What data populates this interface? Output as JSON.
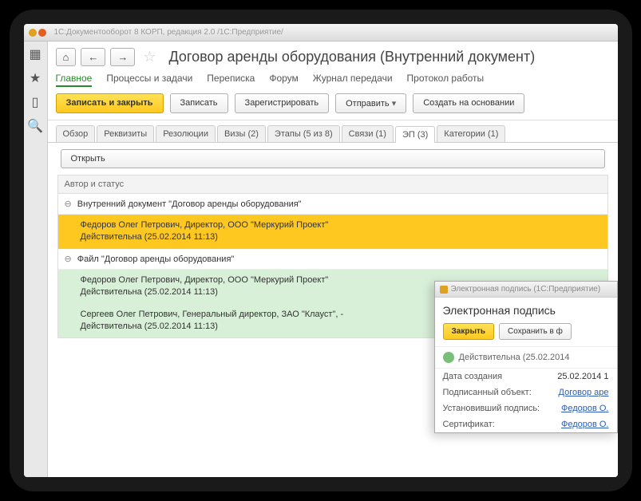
{
  "window": {
    "title": "1С:Документооборот 8 КОРП, редакция 2.0 /1С:Предприятие/"
  },
  "page": {
    "title": "Договор аренды оборудования (Внутренний документ)"
  },
  "nav": {
    "tabs": [
      {
        "label": "Главное"
      },
      {
        "label": "Процессы и задачи"
      },
      {
        "label": "Переписка"
      },
      {
        "label": "Форум"
      },
      {
        "label": "Журнал передачи"
      },
      {
        "label": "Протокол работы"
      }
    ]
  },
  "actions": {
    "save_close": "Записать и закрыть",
    "save": "Записать",
    "register": "Зарегистрировать",
    "send": "Отправить",
    "create_based": "Создать на основании"
  },
  "sub_tabs": [
    {
      "label": "Обзор"
    },
    {
      "label": "Реквизиты"
    },
    {
      "label": "Резолюции"
    },
    {
      "label": "Визы (2)"
    },
    {
      "label": "Этапы (5 из 8)"
    },
    {
      "label": "Связи (1)"
    },
    {
      "label": "ЭП (3)"
    },
    {
      "label": "Категории (1)"
    }
  ],
  "open_label": "Открыть",
  "list": {
    "header": "Автор и статус",
    "rows": [
      {
        "type": "group",
        "label": "Внутренний документ \"Договор аренды оборудования\""
      },
      {
        "type": "detail",
        "style": "yellow",
        "line1": "Федоров Олег Петрович, Директор, ООО \"Меркурий Проект\"",
        "line2": "Действительна (25.02.2014 11:13)"
      },
      {
        "type": "group",
        "label": "Файл \"Договор аренды оборудования\""
      },
      {
        "type": "detail",
        "style": "green",
        "line1": "Федоров Олег Петрович, Директор, ООО \"Меркурий Проект\"",
        "line2": "Действительна (25.02.2014 11:13)"
      },
      {
        "type": "detail",
        "style": "green",
        "line1": "Сергеев Олег Петрович, Генеральный директор, ЗАО \"Клауст\", -",
        "line2": "Действительна (25.02.2014 11:13)"
      }
    ]
  },
  "popup": {
    "bar": "Электронная подпись (1С:Предприятие)",
    "title": "Электронная подпись",
    "close": "Закрыть",
    "save_to_file": "Сохранить в ф",
    "status": "Действительна (25.02.2014",
    "fields": [
      {
        "k": "Дата создания",
        "v": "25.02.2014 1",
        "plain": true
      },
      {
        "k": "Подписанный объект:",
        "v": "Договор аре"
      },
      {
        "k": "Установивший подпись:",
        "v": "Федоров О."
      },
      {
        "k": "Сертификат:",
        "v": "Федоров О."
      }
    ]
  }
}
